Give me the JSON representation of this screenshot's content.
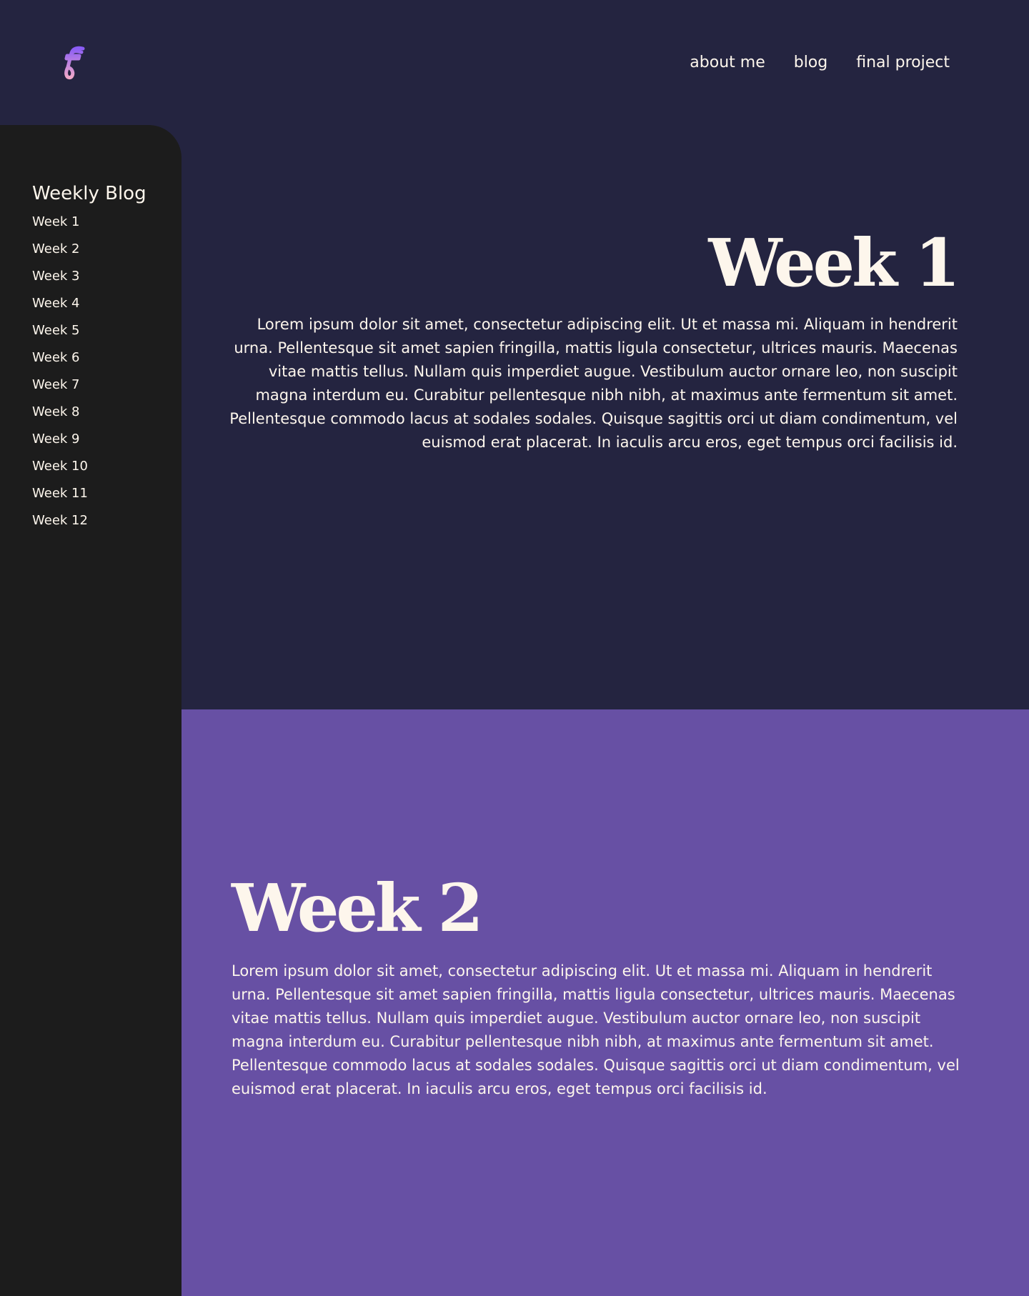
{
  "colors": {
    "header_bg": "#242440",
    "sidebar_bg": "#1c1c1c",
    "section_dark": "#242440",
    "section_purple": "#6750a4",
    "text": "#fdf6ec",
    "logo_gradient_start": "#8a5cf6",
    "logo_gradient_end": "#f0a8c8"
  },
  "header": {
    "logo_icon": "f-monogram-logo",
    "nav": [
      {
        "label": "about me"
      },
      {
        "label": "blog"
      },
      {
        "label": "final project"
      }
    ]
  },
  "sidebar": {
    "title": "Weekly Blog",
    "items": [
      {
        "label": "Week 1"
      },
      {
        "label": "Week 2"
      },
      {
        "label": "Week 3"
      },
      {
        "label": "Week 4"
      },
      {
        "label": "Week 5"
      },
      {
        "label": "Week 6"
      },
      {
        "label": "Week 7"
      },
      {
        "label": "Week 8"
      },
      {
        "label": "Week 9"
      },
      {
        "label": "Week 10"
      },
      {
        "label": "Week 11"
      },
      {
        "label": "Week 12"
      }
    ]
  },
  "sections": [
    {
      "title": "Week 1",
      "body": "Lorem ipsum dolor sit amet, consectetur adipiscing elit. Ut et massa mi. Aliquam in hendrerit urna. Pellentesque sit amet sapien fringilla, mattis ligula consectetur, ultrices mauris. Maecenas vitae mattis tellus. Nullam quis imperdiet augue. Vestibulum auctor ornare leo, non suscipit magna interdum eu. Curabitur pellentesque nibh nibh, at maximus ante fermentum sit amet. Pellentesque commodo lacus at sodales sodales. Quisque sagittis orci ut diam condimentum, vel euismod erat placerat. In iaculis arcu eros, eget tempus orci facilisis id."
    },
    {
      "title": "Week 2",
      "body": "Lorem ipsum dolor sit amet, consectetur adipiscing elit. Ut et massa mi. Aliquam in hendrerit urna. Pellentesque sit amet sapien fringilla, mattis ligula consectetur, ultrices mauris. Maecenas vitae mattis tellus. Nullam quis imperdiet augue. Vestibulum auctor ornare leo, non suscipit magna interdum eu. Curabitur pellentesque nibh nibh, at maximus ante fermentum sit amet. Pellentesque commodo lacus at sodales sodales. Quisque sagittis orci ut diam condimentum, vel euismod erat placerat. In iaculis arcu eros, eget tempus orci facilisis id."
    }
  ]
}
